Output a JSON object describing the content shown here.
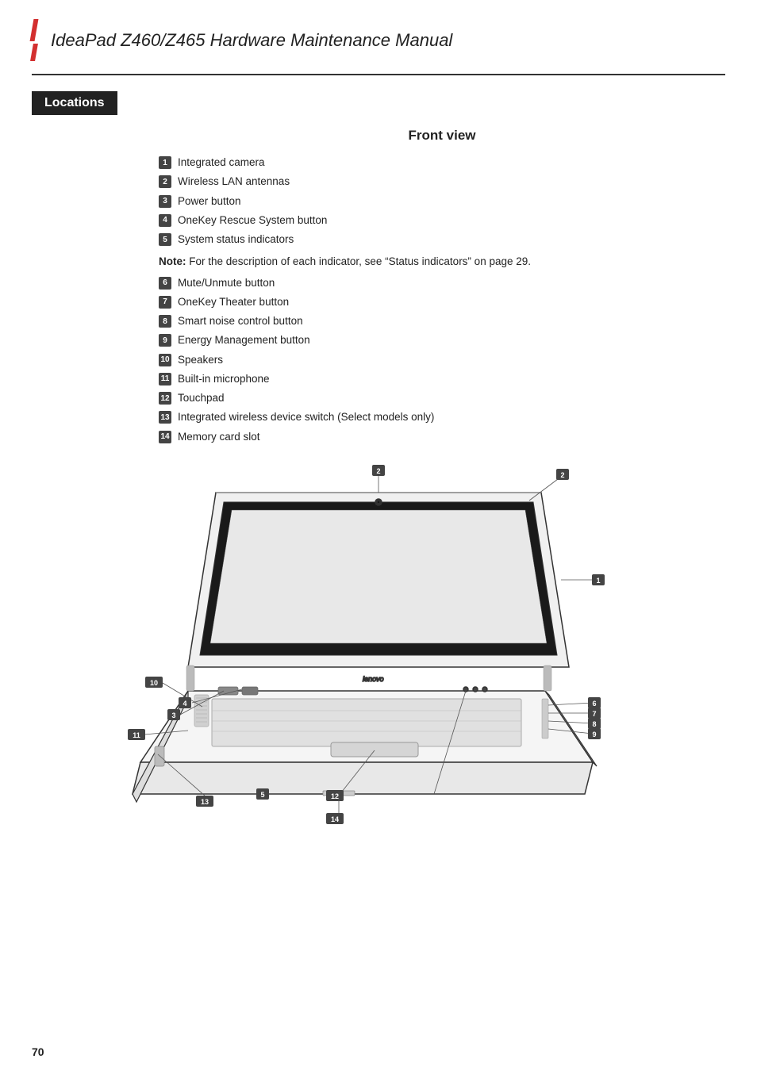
{
  "header": {
    "title": "IdeaPad Z460/Z465 Hardware Maintenance Manual"
  },
  "section": {
    "label": "Locations"
  },
  "frontView": {
    "title": "Front view",
    "items": [
      {
        "id": "1",
        "label": "Integrated camera"
      },
      {
        "id": "2",
        "label": "Wireless LAN antennas"
      },
      {
        "id": "3",
        "label": "Power button"
      },
      {
        "id": "4",
        "label": "OneKey Rescue System button"
      },
      {
        "id": "5",
        "label": "System status indicators"
      },
      {
        "id": "6",
        "label": "Mute/Unmute button"
      },
      {
        "id": "7",
        "label": "OneKey Theater button"
      },
      {
        "id": "8",
        "label": "Smart noise control button"
      },
      {
        "id": "9",
        "label": "Energy Management button"
      },
      {
        "id": "10",
        "label": "Speakers"
      },
      {
        "id": "11",
        "label": "Built-in microphone"
      },
      {
        "id": "12",
        "label": "Touchpad"
      },
      {
        "id": "13",
        "label": "Integrated wireless device switch (Select models only)"
      },
      {
        "id": "14",
        "label": "Memory card slot"
      }
    ],
    "note": "Note:",
    "noteText": " For the description of each indicator, see “Status indicators” on page 29."
  },
  "pageNumber": "70"
}
